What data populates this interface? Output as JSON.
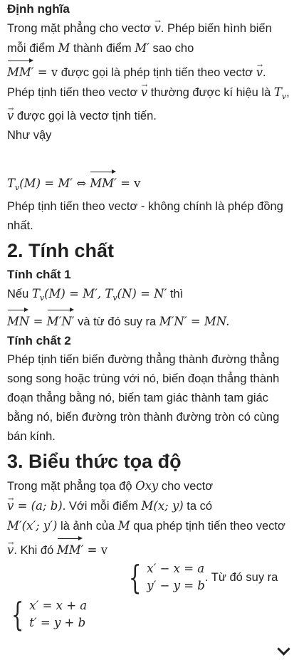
{
  "definition": {
    "heading": "Định nghĩa",
    "p1_a": "Trong mặt phẳng cho vectơ ",
    "p1_b": ". Phép biến hình biến mỗi điểm ",
    "p1_c": " thành điểm ",
    "p1_d": " sao cho",
    "p1_e": " được gọi là phép tịnh tiến theo vectơ",
    "p2_a": "Phép tịnh tiến theo vectơ ",
    "p2_b": " thường được kí hiệu là ",
    "p2_c": " được gọi là vectơ tịnh tiến.",
    "p3": "Như vậy",
    "p4": "Phép tịnh tiến theo vectơ - không chính là phép đồng nhất."
  },
  "section2": {
    "title": "2. Tính chất",
    "prop1_heading": "Tính chất 1",
    "prop1_a": "Nếu ",
    "prop1_b": " thì",
    "prop1_c": " và từ đó suy ra ",
    "prop2_heading": "Tính chất 2",
    "prop2_text": "Phép tịnh tiến biến đường thẳng thành đường thẳng song song hoặc trùng với nó, biến đoạn thẳng thành đoạn thẳng bằng nó, biến tam giác thành tam giác bằng nó, biến đường tròn thành đường tròn có cùng bán kính."
  },
  "section3": {
    "title": "3. Biểu thức tọa độ",
    "p1_a": "Trong mặt phẳng tọa độ ",
    "p1_b": " cho vectơ",
    "p1_c": ". Với mỗi điểm ",
    "p1_d": " ta có",
    "p1_e": " là ảnh của ",
    "p1_f": " qua phép tịnh tiến theo vectơ ",
    "p1_g": ". Khi đó ",
    "p1_h": ". Từ đó suy ra"
  },
  "math": {
    "v": "v",
    "M": "M",
    "Mprime": "M′",
    "MMprime": "MM′",
    "eq_v": " = v",
    "Tv": "T",
    "sub_v": "v",
    "TvM": "(M) = M′ ⇔ ",
    "TvM2": "(M) = M′, ",
    "TvN": "(N) = N′",
    "MN": "MN",
    "MprimeNprime": "M′N′",
    "eq": " = ",
    "MNeq": "M′N′ = MN.",
    "Oxy": "Oxy",
    "v_ab": " = (a; b)",
    "Mxy": "M(x; y)",
    "Mpxy": "M′(x′; y′)",
    "sys1_l1": "x′ − x = a",
    "sys1_l2": "y′ − y = b",
    "sys2_l1": "x′ = x + a",
    "sys2_l2": "t′ = y + b"
  },
  "icons": {
    "bottom": "chevron-down-icon"
  }
}
